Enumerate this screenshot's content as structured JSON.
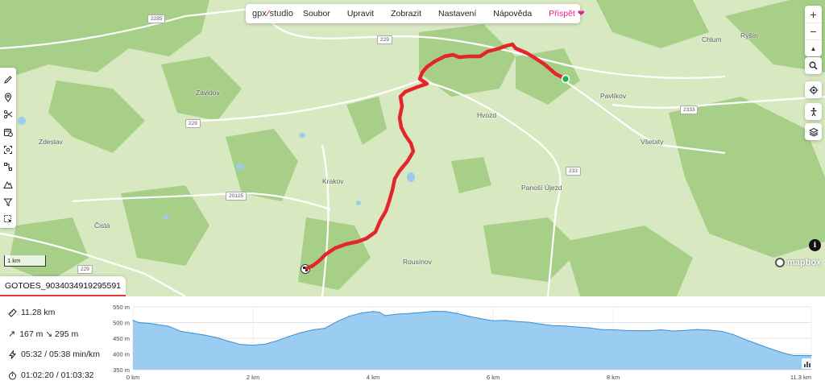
{
  "menu": {
    "logo_left": "gpx",
    "logo_right": "studio",
    "items": [
      "Soubor",
      "Upravit",
      "Zobrazit",
      "Nastavení",
      "Nápověda"
    ],
    "support_label": "Přispět"
  },
  "toolbar": {
    "tools": [
      "pencil-icon",
      "pin-icon",
      "scissors-icon",
      "calendar-clock-icon",
      "scan-icon",
      "route-nodes-icon",
      "mountain-icon",
      "filter-icon",
      "select-area-icon"
    ]
  },
  "controls": {
    "zoom_in": "+",
    "zoom_out": "−",
    "compass": "▲"
  },
  "map": {
    "places": [
      {
        "name": "Chlum",
        "id": "chlum"
      },
      {
        "name": "Ryšín",
        "id": "rysin"
      },
      {
        "name": "Zavidov",
        "id": "zavidov"
      },
      {
        "name": "Pavlíkov",
        "id": "pavlikov"
      },
      {
        "name": "Hvozd",
        "id": "hvozd"
      },
      {
        "name": "Všetaty",
        "id": "vsetaty"
      },
      {
        "name": "Zdeslav",
        "id": "zdeslav"
      },
      {
        "name": "Krakov",
        "id": "krakov"
      },
      {
        "name": "Panoší Újezd",
        "id": "panosi"
      },
      {
        "name": "Čistá",
        "id": "cista"
      },
      {
        "name": "Rousínov",
        "id": "rousinov"
      }
    ],
    "roads": [
      "2285",
      "229",
      "229",
      "2333",
      "233",
      "20125",
      "229"
    ],
    "scale_label": "1 km",
    "attribution": "mapbox",
    "track_name": "GOTOES_9034034919295591",
    "track_color": "#e3262a",
    "start_color": "#22b24c"
  },
  "stats": {
    "distance": "11.28 km",
    "elevation": "167 m ↘ 295 m",
    "speed": "05:32 / 05:38 min/km",
    "duration": "01:02:20 / 01:03:32"
  },
  "chart_data": {
    "type": "area",
    "title": "",
    "xlabel": "",
    "ylabel": "",
    "xlim": [
      0,
      11.3
    ],
    "ylim": [
      350,
      550
    ],
    "x_ticks": [
      "0 km",
      "2 km",
      "4 km",
      "6 km",
      "8 km",
      "11.3 km"
    ],
    "y_ticks": [
      "550 m",
      "500 m",
      "450 m",
      "400 m",
      "350 m"
    ],
    "fill_color": "#8fc8ef",
    "line_color": "#3b8fd6",
    "series": [
      {
        "x": [
          0,
          0.1,
          0.3,
          0.6,
          0.8,
          1.0,
          1.2,
          1.4,
          1.6,
          1.8,
          2.0,
          2.2,
          2.4,
          2.6,
          2.8,
          3.0,
          3.2,
          3.4,
          3.6,
          3.8,
          4.0,
          4.1,
          4.2,
          4.4,
          4.6,
          4.8,
          5.0,
          5.2,
          5.4,
          5.6,
          5.8,
          6.0,
          6.2,
          6.4,
          6.6,
          6.8,
          7.0,
          7.2,
          7.4,
          7.6,
          7.8,
          8.0,
          8.2,
          8.4,
          8.6,
          8.8,
          9.0,
          9.2,
          9.4,
          9.6,
          9.8,
          10.0,
          10.2,
          10.4,
          10.6,
          10.8,
          11.0,
          11.3
        ],
        "y": [
          507,
          500,
          497,
          488,
          472,
          466,
          460,
          452,
          440,
          430,
          428,
          431,
          442,
          456,
          468,
          477,
          482,
          503,
          520,
          530,
          535,
          533,
          522,
          527,
          529,
          532,
          536,
          535,
          529,
          520,
          512,
          506,
          507,
          503,
          501,
          495,
          490,
          489,
          486,
          483,
          478,
          477,
          475,
          474,
          474,
          477,
          473,
          475,
          478,
          476,
          472,
          462,
          446,
          432,
          418,
          405,
          395,
          395
        ]
      }
    ]
  }
}
